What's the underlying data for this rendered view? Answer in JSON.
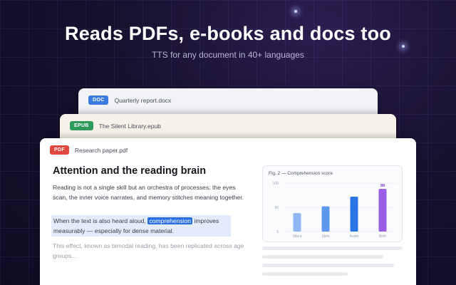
{
  "hero": {
    "title": "Reads PDFs, e-books and docs too",
    "subtitle": "TTS for any document in 40+ languages"
  },
  "cards": {
    "doc": {
      "badge": "DOC",
      "filename": "Quarterly report.docx"
    },
    "epub": {
      "badge": "EPUB",
      "filename": "The Silent Library.epub"
    },
    "pdf": {
      "badge": "PDF",
      "filename": "Research paper.pdf"
    }
  },
  "article": {
    "title": "Attention and the reading brain",
    "para1": "Reading is not a single skill but an orchestra of processes: the eyes scan, the inner voice narrates, and memory stitches meaning together.",
    "para2_before": "When the text is also heard aloud, ",
    "para2_highlight": "comprehension",
    "para2_after": " improves measurably — especially for dense material.",
    "para3": "This effect, known as bimodal reading, has been replicated across age groups..."
  },
  "chart_data": {
    "type": "bar",
    "title": "Fig. 2 — Comprehension score",
    "categories": [
      "Silent",
      "Skim",
      "Audio",
      "Both"
    ],
    "values": [
      38,
      52,
      72,
      88
    ],
    "data_labels": [
      "",
      "",
      "",
      "88"
    ],
    "ylim": [
      0,
      100
    ],
    "yticks": [
      0,
      50,
      100
    ],
    "grid": true,
    "colors": [
      "#8fb6f2",
      "#5d97ec",
      "#2a75e6",
      "#9b5de5"
    ]
  }
}
